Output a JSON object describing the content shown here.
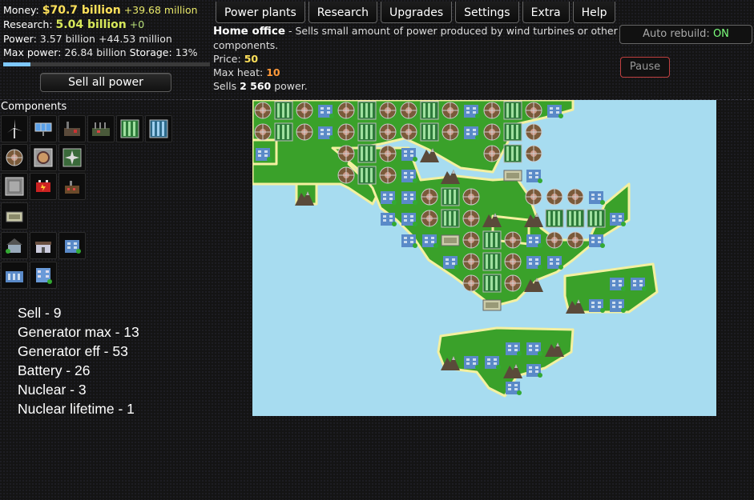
{
  "stats": {
    "money_label": "Money:",
    "money_value": "$70.7 billion",
    "money_delta": "+39.68 million",
    "research_label": "Research:",
    "research_value": "5.04 billion",
    "research_delta": "+0",
    "power_label": "Power:",
    "power_value": "3.57 billion",
    "power_delta": "+44.53 million",
    "maxpower_label": "Max power:",
    "maxpower_value": "26.84 billion",
    "storage_label": "Storage:",
    "storage_value": "13%",
    "storage_fraction": 0.13
  },
  "buttons": {
    "sell_all": "Sell all power",
    "auto_rebuild_label": "Auto rebuild:",
    "auto_rebuild_state": "ON",
    "pause": "Pause"
  },
  "tabs": [
    "Power plants",
    "Research",
    "Upgrades",
    "Settings",
    "Extra",
    "Help"
  ],
  "info": {
    "name": "Home office",
    "description": " - Sells small amount of power produced by wind turbines or other components.",
    "price_label": "Price:",
    "price_value": "50",
    "maxheat_label": "Max heat:",
    "maxheat_value": "10",
    "sells_prefix": "Sells",
    "sells_value": "2 560",
    "sells_suffix": "power."
  },
  "components_title": "Components",
  "components": [
    [
      "wind-turbine",
      "solar-panel",
      "coal-plant",
      "factory",
      "generator",
      "generator-blue"
    ],
    [
      "heat-exchanger",
      "reactor-core",
      "cooling-fan"
    ],
    [
      "heat-sink",
      "battery-red",
      "small-plant"
    ],
    [
      "battery"
    ],
    [
      "small-house",
      "house",
      "office"
    ],
    [
      "bank",
      "home-office"
    ]
  ],
  "notes": [
    "Sell - 9",
    "Generator max - 13",
    "Generator eff - 53",
    "Battery - 26",
    "Nuclear - 3",
    "Nuclear lifetime - 1"
  ],
  "colors": {
    "water": "#a7dcf0",
    "grass": "#3aa12a",
    "money": "#ffe15a",
    "research": "#d7e85a",
    "heat": "#ff9a3a",
    "on": "#7cff7c"
  }
}
